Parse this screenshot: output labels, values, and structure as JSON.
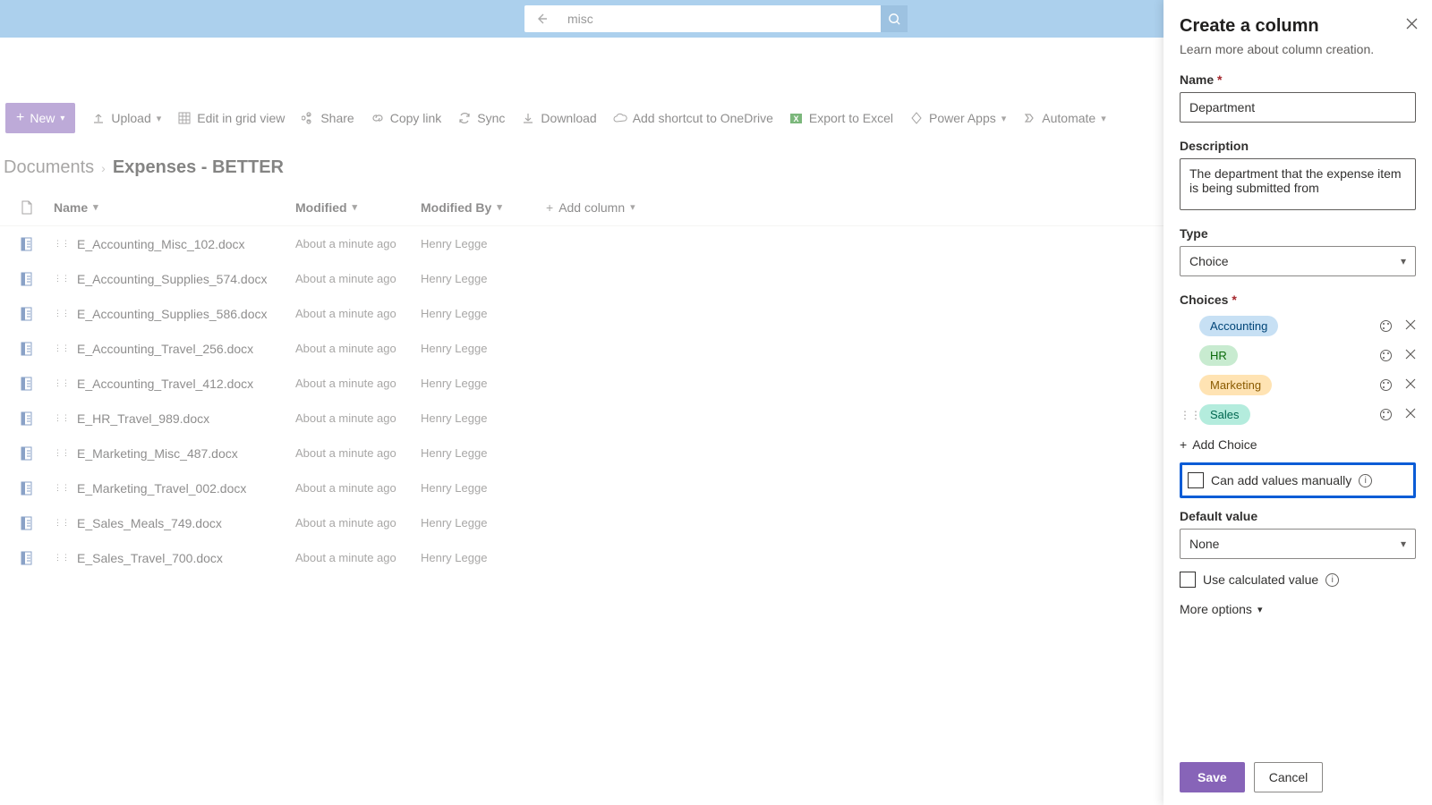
{
  "search": {
    "value": "misc"
  },
  "commands": {
    "new": "New",
    "upload": "Upload",
    "edit_grid": "Edit in grid view",
    "share": "Share",
    "copy_link": "Copy link",
    "sync": "Sync",
    "download": "Download",
    "add_shortcut": "Add shortcut to OneDrive",
    "export_excel": "Export to Excel",
    "power_apps": "Power Apps",
    "automate": "Automate"
  },
  "breadcrumb": {
    "root": "Documents",
    "current": "Expenses - BETTER"
  },
  "columns": {
    "name": "Name",
    "modified": "Modified",
    "modified_by": "Modified By",
    "add": "Add column"
  },
  "rows": [
    {
      "name": "E_Accounting_Misc_102.docx",
      "modified": "About a minute ago",
      "by": "Henry Legge"
    },
    {
      "name": "E_Accounting_Supplies_574.docx",
      "modified": "About a minute ago",
      "by": "Henry Legge"
    },
    {
      "name": "E_Accounting_Supplies_586.docx",
      "modified": "About a minute ago",
      "by": "Henry Legge"
    },
    {
      "name": "E_Accounting_Travel_256.docx",
      "modified": "About a minute ago",
      "by": "Henry Legge"
    },
    {
      "name": "E_Accounting_Travel_412.docx",
      "modified": "About a minute ago",
      "by": "Henry Legge"
    },
    {
      "name": "E_HR_Travel_989.docx",
      "modified": "About a minute ago",
      "by": "Henry Legge"
    },
    {
      "name": "E_Marketing_Misc_487.docx",
      "modified": "About a minute ago",
      "by": "Henry Legge"
    },
    {
      "name": "E_Marketing_Travel_002.docx",
      "modified": "About a minute ago",
      "by": "Henry Legge"
    },
    {
      "name": "E_Sales_Meals_749.docx",
      "modified": "About a minute ago",
      "by": "Henry Legge"
    },
    {
      "name": "E_Sales_Travel_700.docx",
      "modified": "About a minute ago",
      "by": "Henry Legge"
    }
  ],
  "panel": {
    "title": "Create a column",
    "learn_more": "Learn more about column creation.",
    "name_label": "Name",
    "name_value": "Department",
    "desc_label": "Description",
    "desc_value": "The department that the expense item is being submitted from",
    "type_label": "Type",
    "type_value": "Choice",
    "choices_label": "Choices",
    "choices": [
      {
        "label": "Accounting",
        "cls": "pill-accounting"
      },
      {
        "label": "HR",
        "cls": "pill-hr"
      },
      {
        "label": "Marketing",
        "cls": "pill-marketing"
      },
      {
        "label": "Sales",
        "cls": "pill-sales"
      }
    ],
    "add_choice": "Add Choice",
    "manual_label": "Can add values manually",
    "default_label": "Default value",
    "default_value": "None",
    "calc_label": "Use calculated value",
    "more_options": "More options",
    "save": "Save",
    "cancel": "Cancel"
  }
}
